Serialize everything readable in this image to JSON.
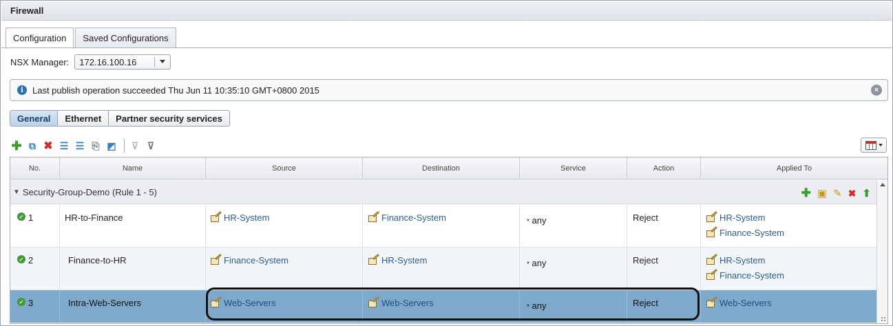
{
  "window": {
    "title": "Firewall"
  },
  "tabs": [
    {
      "label": "Configuration",
      "active": true
    },
    {
      "label": "Saved Configurations",
      "active": false
    }
  ],
  "nsx_manager": {
    "label": "NSX Manager:",
    "value": "172.16.100.16"
  },
  "banner": {
    "message": "Last publish operation succeeded Thu Jun 11 10:35:10 GMT+0800 2015"
  },
  "subtabs": [
    {
      "label": "General",
      "active": true
    },
    {
      "label": "Ethernet",
      "active": false
    },
    {
      "label": "Partner security services",
      "active": false
    }
  ],
  "table": {
    "columns": [
      "No.",
      "Name",
      "Source",
      "Destination",
      "Service",
      "Action",
      "Applied To"
    ],
    "section": {
      "label": "Security-Group-Demo (Rule 1 - 5)"
    },
    "rows": [
      {
        "no": "1",
        "name": "HR-to-Finance",
        "source": [
          "HR-System"
        ],
        "destination": [
          "Finance-System"
        ],
        "service": "any",
        "action": "Reject",
        "applied_to": [
          "HR-System",
          "Finance-System"
        ]
      },
      {
        "no": "2",
        "name": "Finance-to-HR",
        "source": [
          "Finance-System"
        ],
        "destination": [
          "HR-System"
        ],
        "service": "any",
        "action": "Reject",
        "applied_to": [
          "HR-System",
          "Finance-System"
        ]
      },
      {
        "no": "3",
        "name": "Intra-Web-Servers",
        "source": [
          "Web-Servers"
        ],
        "destination": [
          "Web-Servers"
        ],
        "service": "any",
        "action": "Reject",
        "applied_to": [
          "Web-Servers"
        ]
      }
    ]
  },
  "colors": {
    "selected_row": "#7fa9cb",
    "link": "#2a5d93",
    "add_green": "#3f9c35",
    "delete_red": "#d02b2b"
  }
}
